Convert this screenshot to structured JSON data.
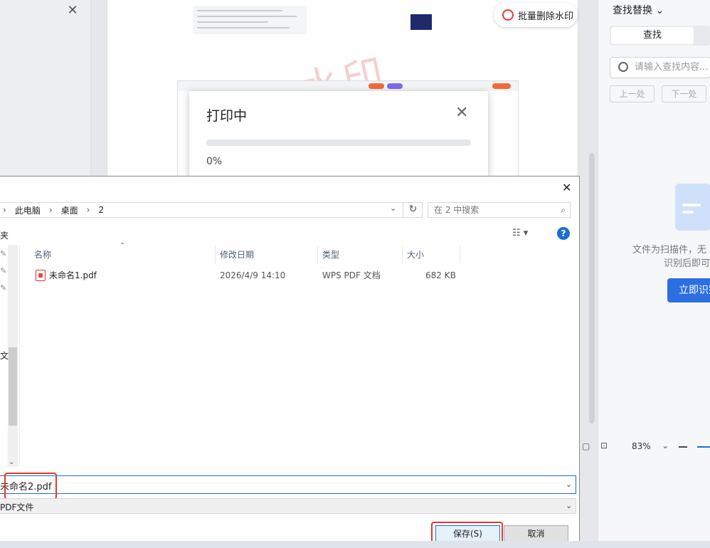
{
  "background_app": {
    "close_glyph": "✕",
    "watermark_text": "水印",
    "batch_remove_watermark_label": "批量删除水印"
  },
  "print_dialog": {
    "title": "打印中",
    "close_glyph": "✕",
    "progress_percent_text": "0%",
    "progress_value": 0
  },
  "right_pane": {
    "title": "查找替换",
    "title_arrow": "⌄",
    "tab_find": "查找",
    "search_placeholder": "请输入查找内容...",
    "prev_button": "上一处",
    "next_button": "下一处",
    "scanned_message_line1": "文件为扫描件，无",
    "scanned_message_line2": "识别后即可",
    "ocr_button": "立即识别",
    "zoom_text": "83%"
  },
  "save_dialog": {
    "close_glyph": "✕",
    "breadcrumb": [
      "此电脑",
      "桌面",
      "2"
    ],
    "search_placeholder": "在 2 中搜索",
    "toolbar_label": "夹",
    "help_glyph": "?",
    "columns": {
      "name": "名称",
      "modified": "修改日期",
      "type": "类型",
      "size": "大小"
    },
    "files": [
      {
        "name": "未命名1.pdf",
        "modified": "2026/4/9 14:10",
        "type": "WPS PDF 文档",
        "size": "682 KB"
      }
    ],
    "nav_fragment_text": "文",
    "filename_value": "未命名2.pdf",
    "filetype_value": "PDF文件",
    "save_button": "保存(S)",
    "cancel_button": "取消"
  },
  "colors": {
    "accent_blue": "#1b6fd3",
    "highlight_red": "#e03a2b",
    "ocr_button_blue": "#2d6fe0"
  }
}
